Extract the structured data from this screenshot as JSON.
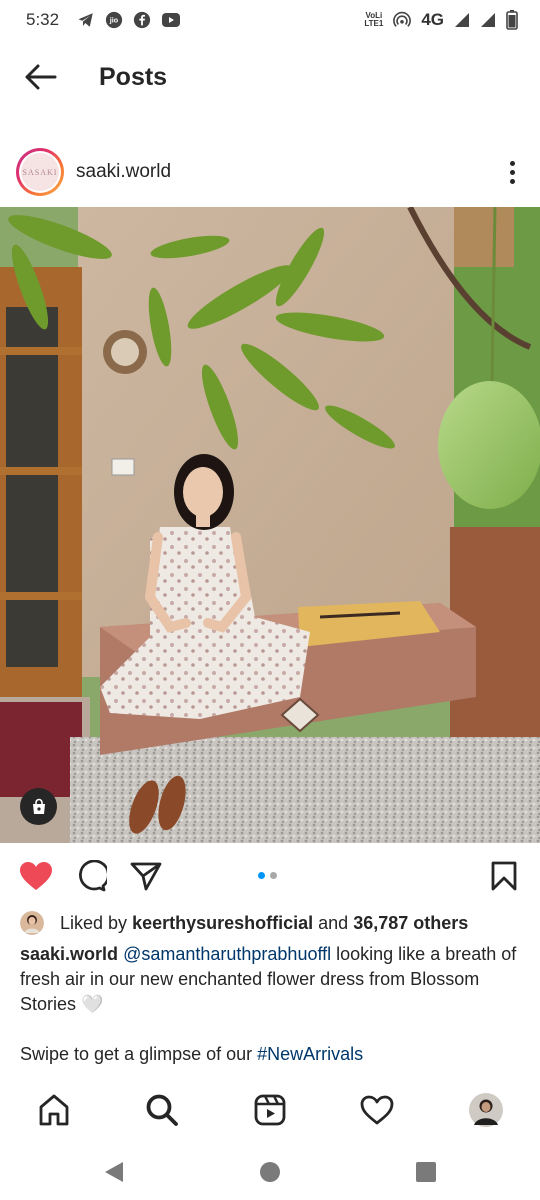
{
  "status_bar": {
    "time": "5:32",
    "icons_left": [
      "telegram-icon",
      "jio-icon",
      "facebook-icon",
      "youtube-icon"
    ],
    "volte_label_top": "VoLi",
    "volte_label_bottom": "LTE1",
    "network": "4G",
    "icons_right": [
      "hotspot-icon",
      "signal-icon",
      "signal-icon-2",
      "battery-icon"
    ]
  },
  "header": {
    "title": "Posts",
    "back_icon": "arrow-left-icon"
  },
  "post": {
    "username": "saaki.world",
    "avatar_logo_top": "SA",
    "avatar_logo_bottom": "SAKI",
    "more_icon": "more-vertical-icon",
    "image_alt": "Woman in floral dress sitting on a bench under a mango tree"
  },
  "actions": {
    "like_icon": "heart-filled-icon",
    "comment_icon": "comment-icon",
    "share_icon": "send-icon",
    "save_icon": "bookmark-icon",
    "carousel_total": 2,
    "carousel_active": 1,
    "accent_like": "#ed4956",
    "accent_dot": "#0095f6"
  },
  "likes": {
    "prefix": "Liked by ",
    "liker": "keerthysureshofficial",
    "and": " and ",
    "others": "36,787 others"
  },
  "caption": {
    "username": "saaki.world",
    "mention": "@samantharuthprabhuoffl",
    "text": " looking like a breath of fresh air in our new enchanted flower dress from Blossom Stories 🤍",
    "line2_prefix": "Swipe to get a glimpse of our ",
    "hashtag": "#NewArrivals"
  },
  "bottom_nav": {
    "items": [
      "home-icon",
      "search-icon",
      "reels-icon",
      "activity-heart-icon",
      "profile-avatar"
    ]
  },
  "system_nav": {
    "items": [
      "back-triangle",
      "home-circle",
      "recents-square"
    ]
  }
}
